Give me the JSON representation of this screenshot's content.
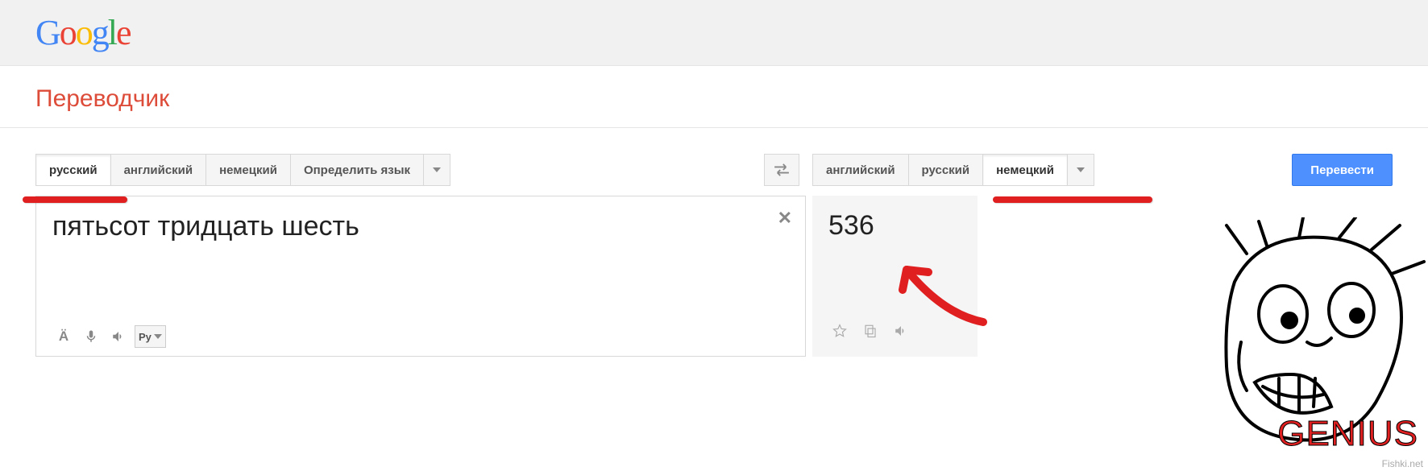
{
  "logo_letters": [
    "G",
    "o",
    "o",
    "g",
    "l",
    "e"
  ],
  "page_title": "Переводчик",
  "source": {
    "tabs": [
      "русский",
      "английский",
      "немецкий",
      "Определить язык"
    ],
    "active_index": 0,
    "text": "пятьсот тридцать шесть",
    "keyboard_label": "Ру"
  },
  "target": {
    "tabs": [
      "английский",
      "русский",
      "немецкий"
    ],
    "active_index": 2,
    "text": "536"
  },
  "translate_button": "Перевести",
  "special_char_label": "Ä",
  "meme_caption": "GENIUS",
  "watermark": "Fishki.net"
}
